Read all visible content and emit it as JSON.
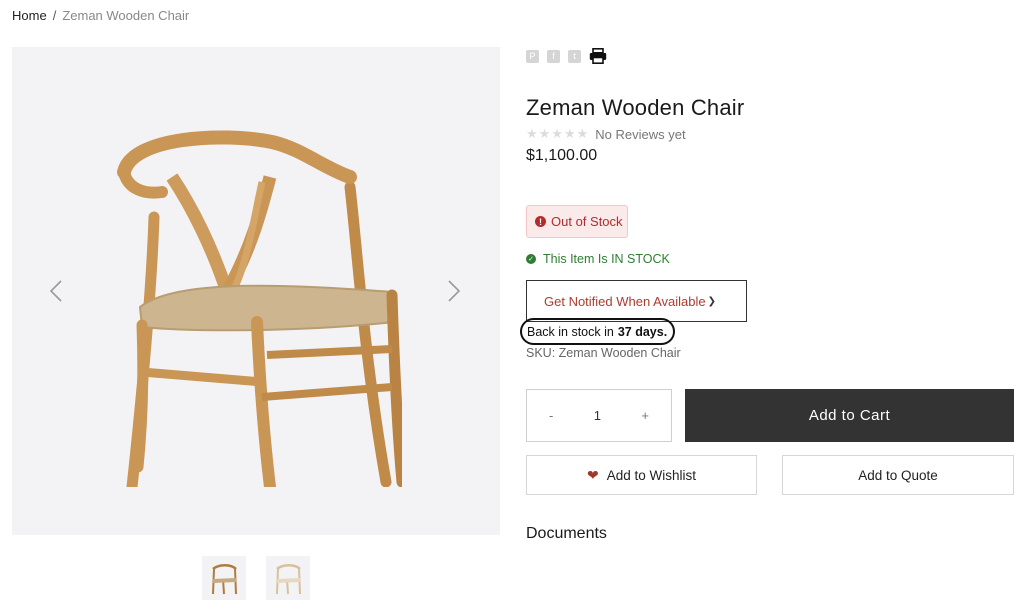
{
  "breadcrumb": {
    "home": "Home",
    "separator": "/",
    "current": "Zeman Wooden Chair"
  },
  "product": {
    "title": "Zeman Wooden Chair",
    "reviews_text": "No Reviews yet",
    "stars": "★★★★★",
    "price": "$1,100.00",
    "out_of_stock_badge": "Out of Stock",
    "in_stock_text": "This Item Is IN STOCK",
    "notify_label": "Get Notified When Available",
    "back_in_stock_prefix": "Back in stock in",
    "back_in_stock_days": "37 days.",
    "sku": "SKU: Zeman Wooden Chair"
  },
  "quantity": {
    "minus": "-",
    "value": "1",
    "plus": "+"
  },
  "actions": {
    "add_to_cart": "Add to Cart",
    "add_to_wishlist": "Add to Wishlist",
    "add_to_quote": "Add to Quote"
  },
  "sections": {
    "documents": "Documents"
  },
  "share_icons": [
    "pinterest-icon",
    "facebook-icon",
    "twitter-icon",
    "print-icon"
  ],
  "colors": {
    "accent_dark": "#333333",
    "out_of_stock_red": "#b32b2b",
    "in_stock_green": "#2e7d32",
    "notify_text": "#b03a2e",
    "heart": "#a0392b",
    "wood": "#c99655",
    "seat_weave": "#cdb590"
  }
}
